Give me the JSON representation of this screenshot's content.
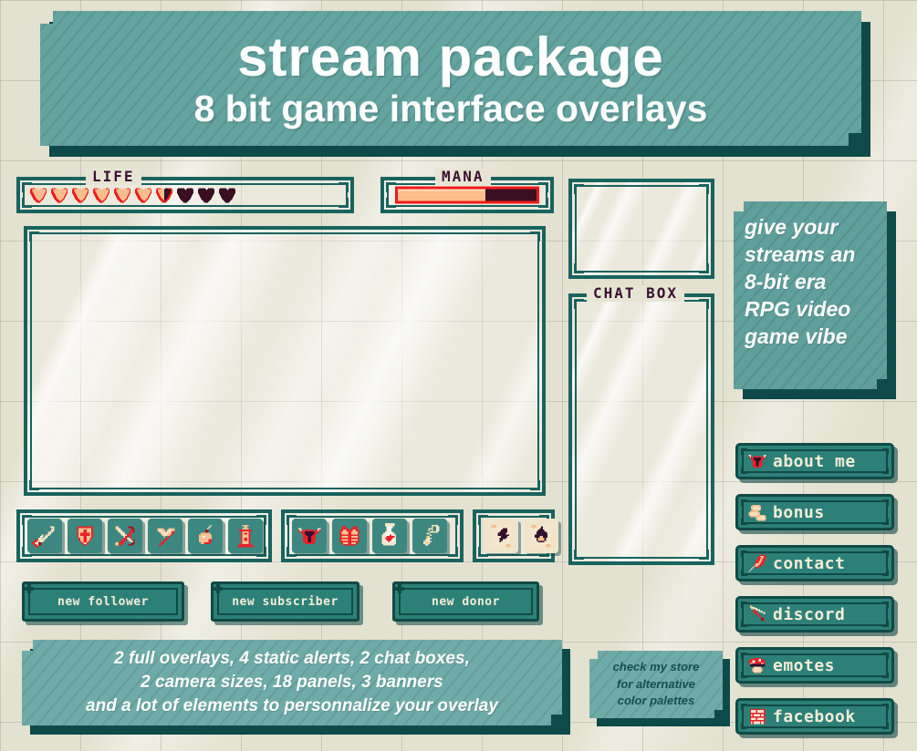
{
  "title_banner": {
    "main": "stream  package",
    "sub": "8 bit game interface overlays"
  },
  "hud": {
    "life": {
      "label": "LIFE",
      "total_hearts": 10,
      "full_hearts": 6,
      "half_hearts": 1,
      "empty_hearts": 3
    },
    "mana": {
      "label": "MANA",
      "fill_percent": 63
    }
  },
  "chat": {
    "label": "CHAT BOX"
  },
  "inventory": {
    "group_1": [
      {
        "name": "sword-icon"
      },
      {
        "name": "shield-icon"
      },
      {
        "name": "bow-icon"
      },
      {
        "name": "axe-icon"
      },
      {
        "name": "bomb-icon"
      },
      {
        "name": "lantern-icon"
      }
    ],
    "group_2": [
      {
        "name": "helmet-icon"
      },
      {
        "name": "armor-icon"
      },
      {
        "name": "potion-icon"
      },
      {
        "name": "key-icon"
      }
    ],
    "group_3": [
      {
        "name": "lightning-scroll-icon"
      },
      {
        "name": "fire-scroll-icon"
      }
    ]
  },
  "alerts": [
    {
      "label": "new follower"
    },
    {
      "label": "new subscriber"
    },
    {
      "label": "new donor"
    }
  ],
  "info_banner": {
    "line1": "2 full overlays, 4 static alerts, 2 chat boxes,",
    "line2": "2 camera sizes, 18 panels, 3 banners",
    "line3": "and a lot of elements to personnalize your overlay"
  },
  "store_note": {
    "line1": "check my store",
    "line2": "for alternative",
    "line3": "color palettes"
  },
  "promo_panel": {
    "line1": "give your",
    "line2": "streams an",
    "line3": "8-bit era",
    "line4": "RPG video",
    "line5": "game vibe"
  },
  "link_buttons": [
    {
      "label": "about me",
      "icon": "helmet-icon"
    },
    {
      "label": "bonus",
      "icon": "coins-icon"
    },
    {
      "label": "contact",
      "icon": "quill-icon"
    },
    {
      "label": "discord",
      "icon": "pickaxe-icon"
    },
    {
      "label": "emotes",
      "icon": "mushroom-icon"
    },
    {
      "label": "facebook",
      "icon": "brick-icon"
    }
  ],
  "colors": {
    "teal_dark": "#0f4a46",
    "teal_mid": "#19635f",
    "teal_button": "#2d8078",
    "teal_banner": "#63a3a0",
    "cream": "#e3e1cf",
    "text_cream": "#f4ecd8",
    "plum": "#3a1030",
    "red": "#ee1c1c",
    "peach": "#fcbd8c"
  }
}
